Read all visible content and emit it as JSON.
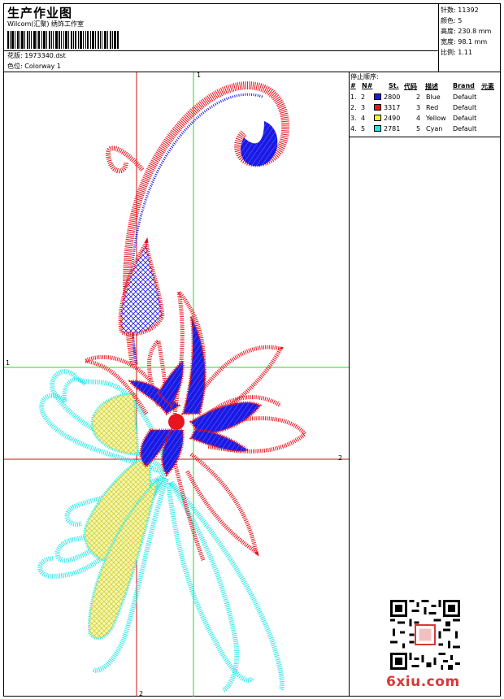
{
  "header": {
    "title": "生产作业图",
    "studio": "Wilcom(汇聚) 绣饰工作室",
    "file_label": "花版:",
    "file_value": "1973340.dst",
    "color_label": "色位:",
    "color_value": "Colorway 1"
  },
  "stats": [
    {
      "label": "针数:",
      "value": "11392"
    },
    {
      "label": "颜色:",
      "value": "5"
    },
    {
      "label": "高度:",
      "value": "230.8 mm"
    },
    {
      "label": "宽度:",
      "value": "98.1 mm"
    },
    {
      "label": "比例:",
      "value": "1.11"
    }
  ],
  "legend": {
    "title": "停止顺序:",
    "headers": {
      "num": "#",
      "needle": "N#",
      "stitches": "St.",
      "code": "代码",
      "desc": "描述",
      "brand": "Brand",
      "element": "元素"
    },
    "rows": [
      {
        "num": "1.",
        "needle": "2",
        "color": "#1a1ae6",
        "stitches": "2800",
        "code": "2",
        "desc": "Blue",
        "brand": "Default"
      },
      {
        "num": "2.",
        "needle": "3",
        "color": "#e8141e",
        "stitches": "3317",
        "code": "3",
        "desc": "Red",
        "brand": "Default"
      },
      {
        "num": "3.",
        "needle": "4",
        "color": "#f5f51e",
        "stitches": "2490",
        "code": "4",
        "desc": "Yellow",
        "brand": "Default"
      },
      {
        "num": "4.",
        "needle": "5",
        "color": "#1ee6e6",
        "stitches": "2781",
        "code": "5",
        "desc": "Cyan",
        "brand": "Default"
      }
    ]
  },
  "guides": {
    "top": "1",
    "left": "1",
    "right": "2",
    "bottom": "2"
  },
  "watermark": "6xiu.com",
  "colors": {
    "blue": "#1a1ae6",
    "red": "#e8141e",
    "yellow": "#f5f58c",
    "cyan": "#2ee8e8",
    "guide_green": "#2ad42a",
    "guide_red": "#d01010"
  }
}
